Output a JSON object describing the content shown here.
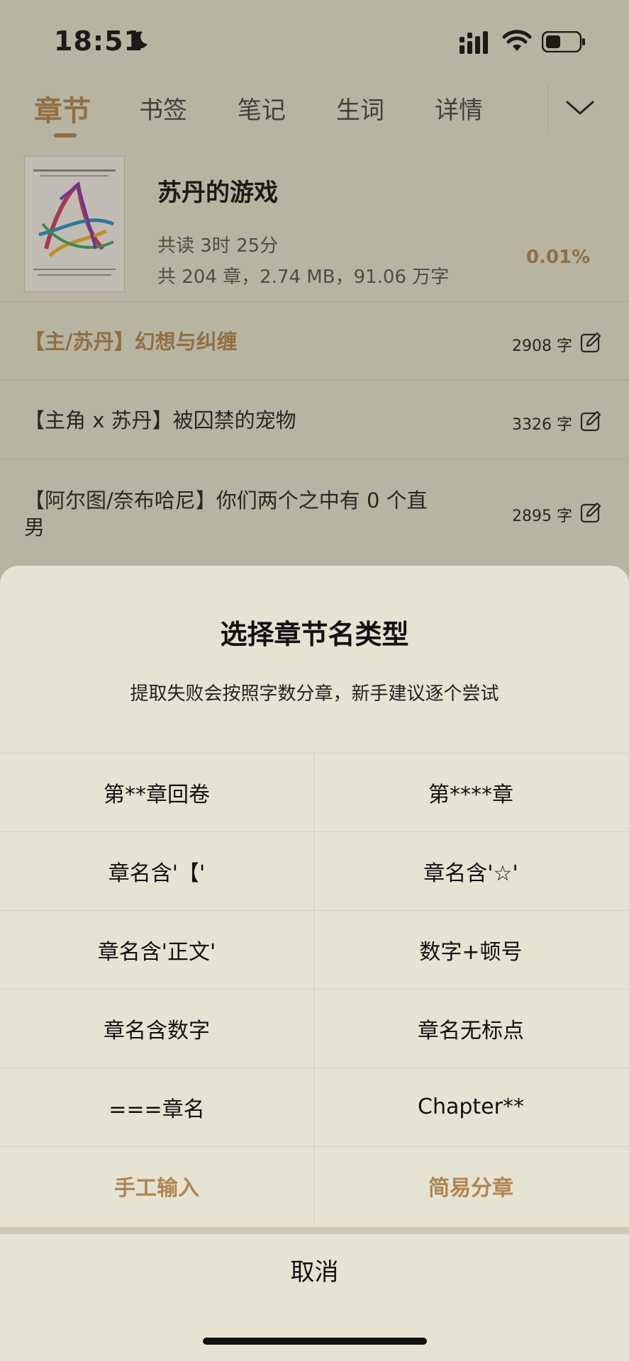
{
  "status": {
    "time": "18:51"
  },
  "tabs": [
    {
      "label": "章节",
      "active": true
    },
    {
      "label": "书签"
    },
    {
      "label": "笔记"
    },
    {
      "label": "生词"
    },
    {
      "label": "详情"
    }
  ],
  "book": {
    "title": "苏丹的游戏",
    "read_time": "共读 3时 25分",
    "stats": "共 204 章，2.74 MB，91.06 万字",
    "progress": "0.01%"
  },
  "chapters": [
    {
      "title": "【主/苏丹】幻想与纠缠",
      "count": "2908 字",
      "active": true
    },
    {
      "title": "【主角 x 苏丹】被囚禁的宠物",
      "count": "3326 字"
    },
    {
      "title_line1": "【阿尔图/奈布哈尼】你们两个之中有 0 个直",
      "title_line2": "男",
      "count": "2895 字"
    }
  ],
  "sheet": {
    "title": "选择章节名类型",
    "subtitle": "提取失败会按照字数分章，新手建议逐个尝试",
    "options": [
      "第**章回卷",
      "第****章",
      "章名含'【'",
      "章名含'☆'",
      "章名含'正文'",
      "数字+顿号",
      "章名含数字",
      "章名无标点",
      "===章名",
      "Chapter**",
      "手工输入",
      "简易分章"
    ],
    "cancel": "取消"
  },
  "colors": {
    "accent": "#b08552",
    "background": "#e8e5d3"
  }
}
